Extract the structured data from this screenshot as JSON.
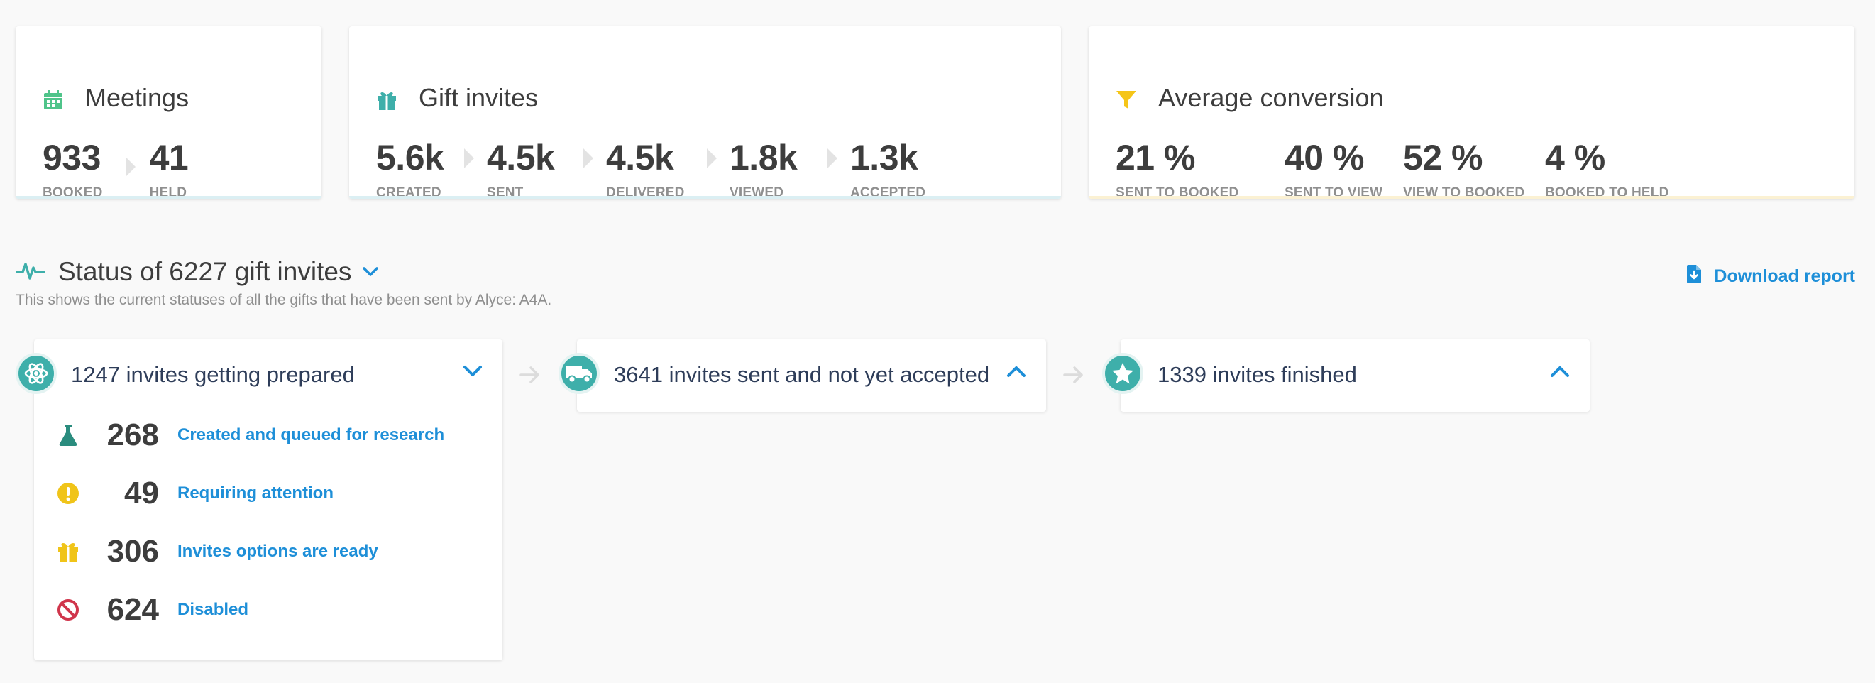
{
  "meetings": {
    "title": "Meetings",
    "stats": [
      {
        "value": "933",
        "label": "BOOKED"
      },
      {
        "value": "41",
        "label": "HELD"
      }
    ]
  },
  "gift_invites": {
    "title": "Gift invites",
    "stats": [
      {
        "value": "5.6k",
        "label": "CREATED"
      },
      {
        "value": "4.5k",
        "label": "SENT"
      },
      {
        "value": "4.5k",
        "label": "DELIVERED"
      },
      {
        "value": "1.8k",
        "label": "VIEWED"
      },
      {
        "value": "1.3k",
        "label": "ACCEPTED"
      }
    ]
  },
  "conversion": {
    "title": "Average conversion",
    "stats": [
      {
        "value": "21 %",
        "label": "SENT TO BOOKED"
      },
      {
        "value": "40 %",
        "label": "SENT TO VIEW"
      },
      {
        "value": "52 %",
        "label": "VIEW TO BOOKED"
      },
      {
        "value": "4 %",
        "label": "BOOKED TO HELD"
      }
    ]
  },
  "status": {
    "title": "Status of 6227 gift invites",
    "subtitle": "This shows the current statuses of all the gifts that have been sent by Alyce: A4A.",
    "download_label": "Download report"
  },
  "stages": [
    {
      "title": "1247 invites getting prepared",
      "items": [
        {
          "count": "268",
          "label": "Created and queued for research",
          "icon": "flask-icon"
        },
        {
          "count": "49",
          "label": "Requiring attention",
          "icon": "alert-icon"
        },
        {
          "count": "306",
          "label": "Invites options are ready",
          "icon": "gift-icon"
        },
        {
          "count": "624",
          "label": "Disabled",
          "icon": "ban-icon"
        }
      ]
    },
    {
      "title": "3641 invites sent and not yet accepted"
    },
    {
      "title": "1339 invites finished"
    }
  ],
  "colors": {
    "accent_blue": "#1e8fd8",
    "teal": "#3eafaa",
    "meeting_green": "#4fc48a",
    "funnel_yellow": "#f5c518",
    "ban_red": "#d0354b"
  }
}
